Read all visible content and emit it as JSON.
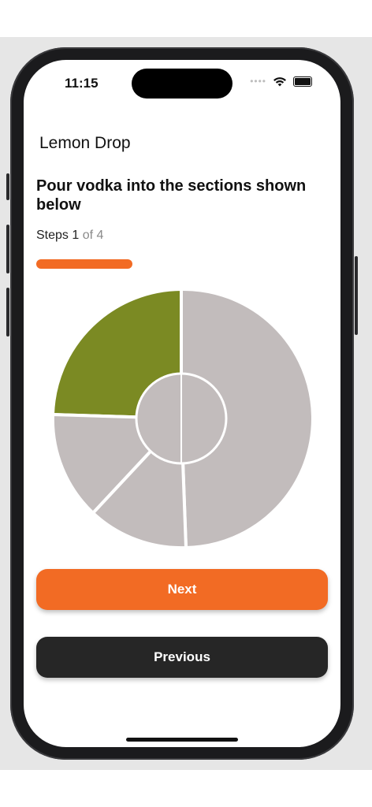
{
  "status_bar": {
    "time": "11:15",
    "signal_icon": "signal-dots-icon",
    "wifi_icon": "wifi-icon",
    "battery_icon": "battery-icon"
  },
  "header": {
    "title": "Lemon Drop"
  },
  "instruction": {
    "text": "Pour vodka into the sections shown below"
  },
  "progress": {
    "steps_label": "Steps",
    "current": "1",
    "of_total": "of 4",
    "fraction": 0.33,
    "color": "#f26b24"
  },
  "diagram": {
    "highlight_color": "#7b8a23",
    "default_color": "#c2bcbc",
    "separator_color": "#ffffff"
  },
  "buttons": {
    "next_label": "Next",
    "next_color": "#f26b24",
    "previous_label": "Previous",
    "previous_color": "#262626"
  }
}
